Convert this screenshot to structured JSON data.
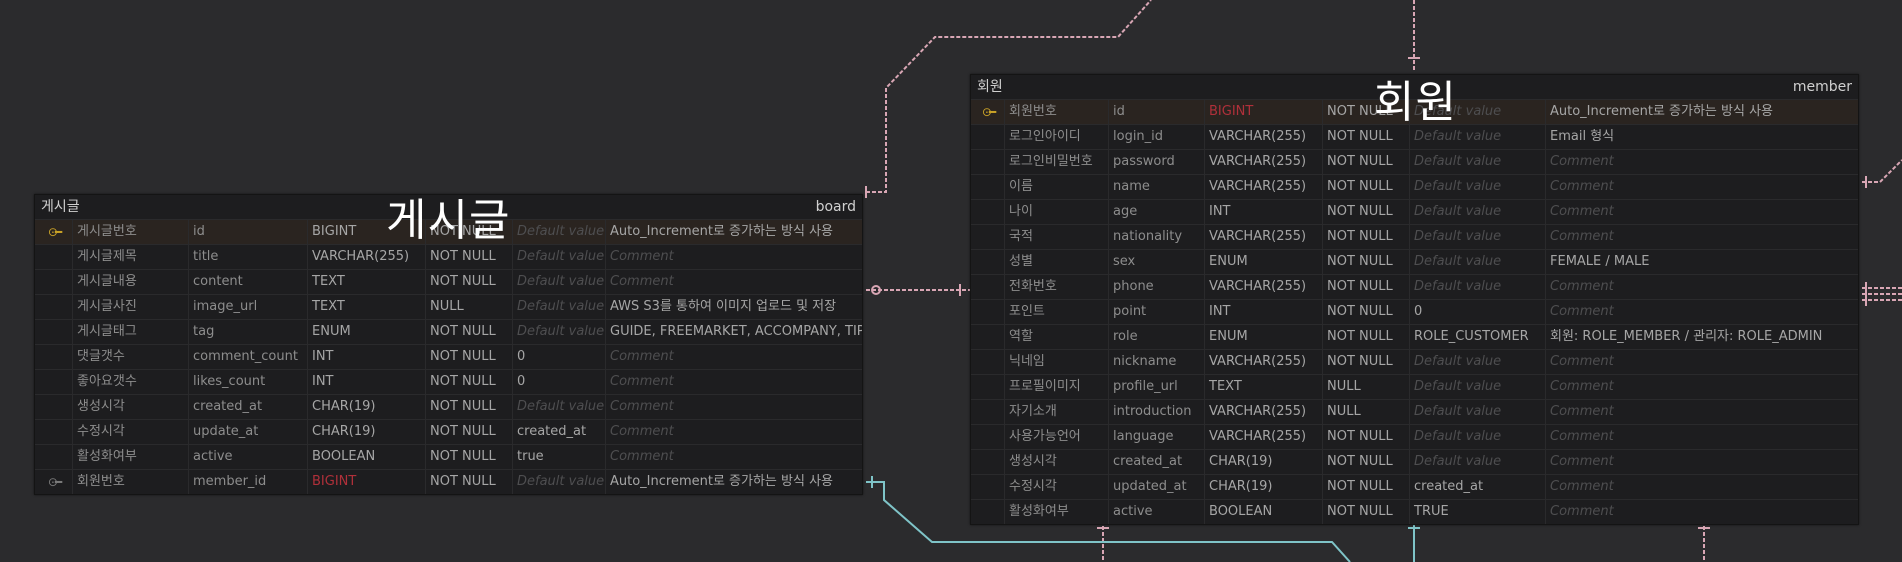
{
  "canvas": {
    "board_big_title": "게시글",
    "member_big_title": "회원"
  },
  "colors": {
    "background": "#2b2b2d",
    "table_bg": "#1d1d1f",
    "pk_row_bg": "#2a2420",
    "fk_type": "#b0303a",
    "key_icon": "#c9a227",
    "relation_pink": "#d8a6b4",
    "relation_teal": "#7fc4c8"
  },
  "board": {
    "logical_name": "게시글",
    "physical_name": "board",
    "columns": [
      {
        "key": "pk",
        "logical": "게시글번호",
        "physical": "id",
        "type": "BIGINT",
        "null": "NOT NULL",
        "default": "Default value",
        "default_placeholder": true,
        "comment": "Auto_Increment로 증가하는 방식 사용",
        "comment_placeholder": false
      },
      {
        "key": "",
        "logical": "게시글제목",
        "physical": "title",
        "type": "VARCHAR(255)",
        "null": "NOT NULL",
        "default": "Default value",
        "default_placeholder": true,
        "comment": "Comment",
        "comment_placeholder": true
      },
      {
        "key": "",
        "logical": "게시글내용",
        "physical": "content",
        "type": "TEXT",
        "null": "NOT NULL",
        "default": "Default value",
        "default_placeholder": true,
        "comment": "Comment",
        "comment_placeholder": true
      },
      {
        "key": "",
        "logical": "게시글사진",
        "physical": "image_url",
        "type": "TEXT",
        "null": "NULL",
        "default": "Default value",
        "default_placeholder": true,
        "comment": "AWS S3를 통하여 이미지 업로드 및 저장",
        "comment_placeholder": false
      },
      {
        "key": "",
        "logical": "게시글태그",
        "physical": "tag",
        "type": "ENUM",
        "null": "NOT NULL",
        "default": "Default value",
        "default_placeholder": true,
        "comment": "GUIDE, FREEMARKET, ACCOMPANY, TIP",
        "comment_placeholder": false
      },
      {
        "key": "",
        "logical": "댓글갯수",
        "physical": "comment_count",
        "type": "INT",
        "null": "NOT NULL",
        "default": "0",
        "default_placeholder": false,
        "comment": "Comment",
        "comment_placeholder": true
      },
      {
        "key": "",
        "logical": "좋아요갯수",
        "physical": "likes_count",
        "type": "INT",
        "null": "NOT NULL",
        "default": "0",
        "default_placeholder": false,
        "comment": "Comment",
        "comment_placeholder": true
      },
      {
        "key": "",
        "logical": "생성시각",
        "physical": "created_at",
        "type": "CHAR(19)",
        "null": "NOT NULL",
        "default": "Default value",
        "default_placeholder": true,
        "comment": "Comment",
        "comment_placeholder": true
      },
      {
        "key": "",
        "logical": "수정시각",
        "physical": "update_at",
        "type": "CHAR(19)",
        "null": "NOT NULL",
        "default": "created_at",
        "default_placeholder": false,
        "comment": "Comment",
        "comment_placeholder": true
      },
      {
        "key": "",
        "logical": "활성화여부",
        "physical": "active",
        "type": "BOOLEAN",
        "null": "NOT NULL",
        "default": "true",
        "default_placeholder": false,
        "comment": "Comment",
        "comment_placeholder": true
      },
      {
        "key": "fk",
        "logical": "회원번호",
        "physical": "member_id",
        "type": "BIGINT",
        "null": "NOT NULL",
        "default": "Default value",
        "default_placeholder": true,
        "comment": "Auto_Increment로 증가하는 방식 사용",
        "comment_placeholder": false
      }
    ]
  },
  "member": {
    "logical_name": "회원",
    "physical_name": "member",
    "columns": [
      {
        "key": "pk",
        "logical": "회원번호",
        "physical": "id",
        "type": "BIGINT",
        "type_fk_color": true,
        "null": "NOT NULL",
        "default": "Default value",
        "default_placeholder": true,
        "comment": "Auto_Increment로 증가하는 방식 사용",
        "comment_placeholder": false
      },
      {
        "key": "",
        "logical": "로그인아이디",
        "physical": "login_id",
        "type": "VARCHAR(255)",
        "null": "NOT NULL",
        "default": "Default value",
        "default_placeholder": true,
        "comment": "Email 형식",
        "comment_placeholder": false
      },
      {
        "key": "",
        "logical": "로그인비밀번호",
        "physical": "password",
        "type": "VARCHAR(255)",
        "null": "NOT NULL",
        "default": "Default value",
        "default_placeholder": true,
        "comment": "Comment",
        "comment_placeholder": true
      },
      {
        "key": "",
        "logical": "이름",
        "physical": "name",
        "type": "VARCHAR(255)",
        "null": "NOT NULL",
        "default": "Default value",
        "default_placeholder": true,
        "comment": "Comment",
        "comment_placeholder": true
      },
      {
        "key": "",
        "logical": "나이",
        "physical": "age",
        "type": "INT",
        "null": "NOT NULL",
        "default": "Default value",
        "default_placeholder": true,
        "comment": "Comment",
        "comment_placeholder": true
      },
      {
        "key": "",
        "logical": "국적",
        "physical": "nationality",
        "type": "VARCHAR(255)",
        "null": "NOT NULL",
        "default": "Default value",
        "default_placeholder": true,
        "comment": "Comment",
        "comment_placeholder": true
      },
      {
        "key": "",
        "logical": "성별",
        "physical": "sex",
        "type": "ENUM",
        "null": "NOT NULL",
        "default": "Default value",
        "default_placeholder": true,
        "comment": "FEMALE / MALE",
        "comment_placeholder": false
      },
      {
        "key": "",
        "logical": "전화번호",
        "physical": "phone",
        "type": "VARCHAR(255)",
        "null": "NOT NULL",
        "default": "Default value",
        "default_placeholder": true,
        "comment": "Comment",
        "comment_placeholder": true
      },
      {
        "key": "",
        "logical": "포인트",
        "physical": "point",
        "type": "INT",
        "null": "NOT NULL",
        "default": "0",
        "default_placeholder": false,
        "comment": "Comment",
        "comment_placeholder": true
      },
      {
        "key": "",
        "logical": "역할",
        "physical": "role",
        "type": "ENUM",
        "null": "NOT NULL",
        "default": "ROLE_CUSTOMER",
        "default_placeholder": false,
        "comment": "회원: ROLE_MEMBER / 관리자: ROLE_ADMIN",
        "comment_placeholder": false
      },
      {
        "key": "",
        "logical": "닉네임",
        "physical": "nickname",
        "type": "VARCHAR(255)",
        "null": "NOT NULL",
        "default": "Default value",
        "default_placeholder": true,
        "comment": "Comment",
        "comment_placeholder": true
      },
      {
        "key": "",
        "logical": "프로필이미지",
        "physical": "profile_url",
        "type": "TEXT",
        "null": "NULL",
        "default": "Default value",
        "default_placeholder": true,
        "comment": "Comment",
        "comment_placeholder": true
      },
      {
        "key": "",
        "logical": "자기소개",
        "physical": "introduction",
        "type": "VARCHAR(255)",
        "null": "NULL",
        "default": "Default value",
        "default_placeholder": true,
        "comment": "Comment",
        "comment_placeholder": true
      },
      {
        "key": "",
        "logical": "사용가능언어",
        "physical": "language",
        "type": "VARCHAR(255)",
        "null": "NOT NULL",
        "default": "Default value",
        "default_placeholder": true,
        "comment": "Comment",
        "comment_placeholder": true
      },
      {
        "key": "",
        "logical": "생성시각",
        "physical": "created_at",
        "type": "CHAR(19)",
        "null": "NOT NULL",
        "default": "Default value",
        "default_placeholder": true,
        "comment": "Comment",
        "comment_placeholder": true
      },
      {
        "key": "",
        "logical": "수정시각",
        "physical": "updated_at",
        "type": "CHAR(19)",
        "null": "NOT NULL",
        "default": "created_at",
        "default_placeholder": false,
        "comment": "Comment",
        "comment_placeholder": true
      },
      {
        "key": "",
        "logical": "활성화여부",
        "physical": "active",
        "type": "BOOLEAN",
        "null": "NOT NULL",
        "default": "TRUE",
        "default_placeholder": false,
        "comment": "Comment",
        "comment_placeholder": true
      }
    ]
  }
}
